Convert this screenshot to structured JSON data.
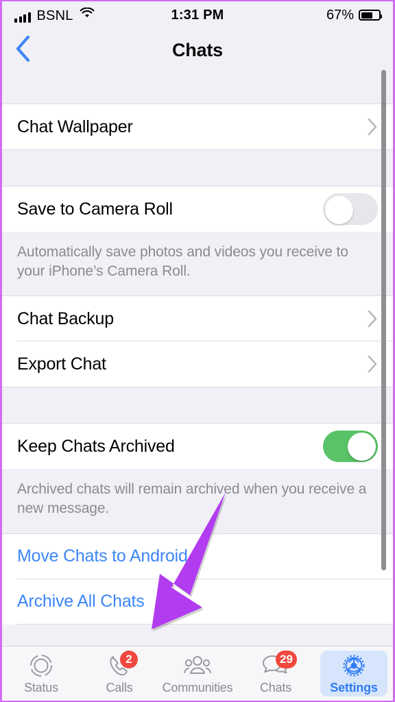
{
  "status_bar": {
    "carrier": "BSNL",
    "time": "1:31 PM",
    "battery_percent": "67%",
    "signal_icon": "signal-bars-icon",
    "wifi_icon": "wifi-icon",
    "battery_icon": "battery-icon"
  },
  "nav": {
    "title": "Chats",
    "back_icon": "chevron-left-icon"
  },
  "sections": {
    "wallpaper_row": {
      "label": "Chat Wallpaper",
      "accessory": "chevron-right-icon"
    },
    "camera_roll_row": {
      "label": "Save to Camera Roll",
      "toggle_state": "off"
    },
    "camera_roll_footer": "Automatically save photos and videos you receive to your iPhone’s Camera Roll.",
    "backup_row": {
      "label": "Chat Backup",
      "accessory": "chevron-right-icon"
    },
    "export_row": {
      "label": "Export Chat",
      "accessory": "chevron-right-icon"
    },
    "keep_archived_row": {
      "label": "Keep Chats Archived",
      "toggle_state": "on"
    },
    "keep_archived_footer": "Archived chats will remain archived when you receive a new message.",
    "move_to_android_row": {
      "label": "Move Chats to Android"
    },
    "archive_all_row": {
      "label": "Archive All Chats"
    }
  },
  "tabs": [
    {
      "label": "Status",
      "icon": "status-ring-icon",
      "badge": "",
      "active": false
    },
    {
      "label": "Calls",
      "icon": "phone-icon",
      "badge": "2",
      "active": false
    },
    {
      "label": "Communities",
      "icon": "communities-people-icon",
      "badge": "",
      "active": false
    },
    {
      "label": "Chats",
      "icon": "chat-bubbles-icon",
      "badge": "29",
      "active": false
    },
    {
      "label": "Settings",
      "icon": "gear-icon",
      "badge": "",
      "active": true
    }
  ],
  "annotation": {
    "arrow_icon": "purple-arrow-icon",
    "points_at": "Archive All Chats"
  },
  "colors": {
    "link_blue": "#3c86f7",
    "toggle_on_green": "#5ac268",
    "badge_red": "#f0483e",
    "accent_purple": "#b23cf0",
    "active_tab_blue": "#2f7cf6"
  }
}
